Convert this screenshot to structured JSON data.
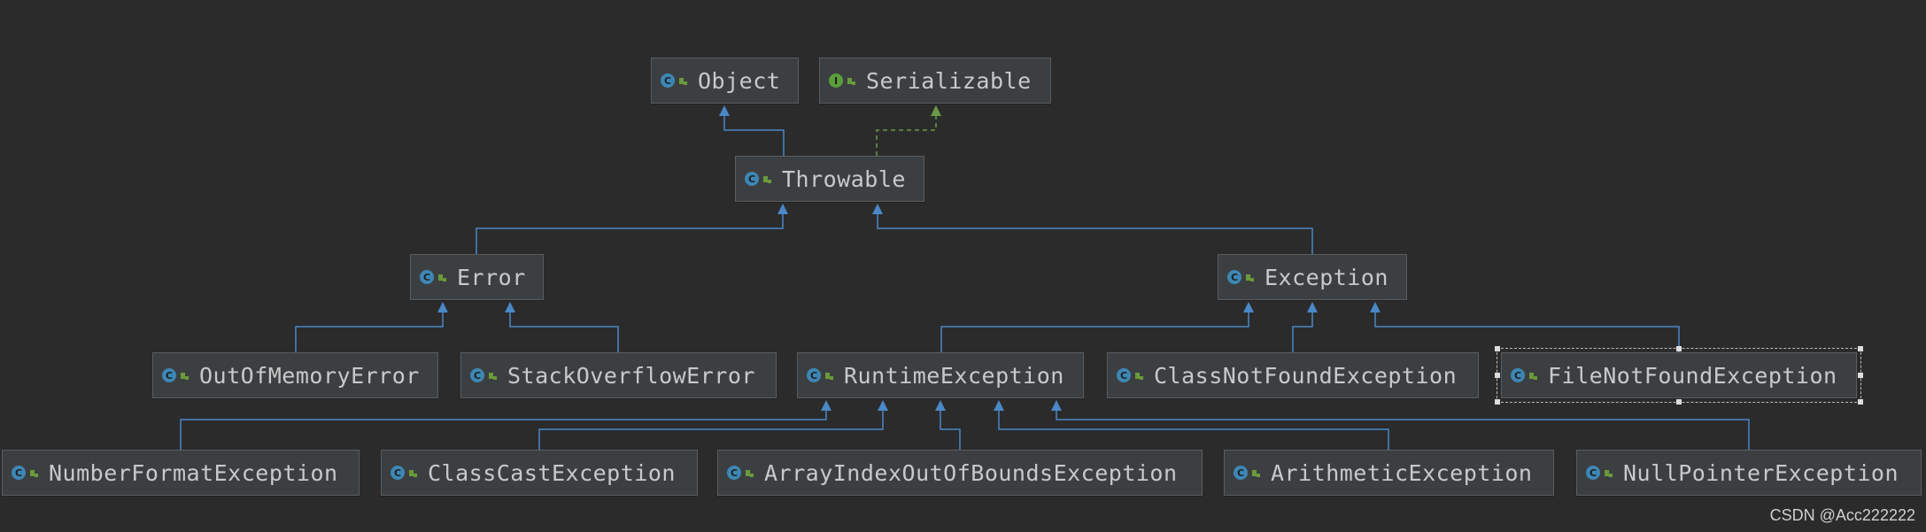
{
  "diagram": {
    "nodes": [
      {
        "id": "object",
        "label": "Object",
        "kind": "class",
        "icon": "class-icon"
      },
      {
        "id": "serializable",
        "label": "Serializable",
        "kind": "interface",
        "icon": "interface-icon"
      },
      {
        "id": "throwable",
        "label": "Throwable",
        "kind": "class",
        "icon": "class-icon"
      },
      {
        "id": "error",
        "label": "Error",
        "kind": "class",
        "icon": "class-icon"
      },
      {
        "id": "exception",
        "label": "Exception",
        "kind": "class",
        "icon": "class-icon"
      },
      {
        "id": "out_of_memory_error",
        "label": "OutOfMemoryError",
        "kind": "class",
        "icon": "class-icon"
      },
      {
        "id": "stack_overflow_error",
        "label": "StackOverflowError",
        "kind": "class",
        "icon": "class-icon"
      },
      {
        "id": "runtime_exception",
        "label": "RuntimeException",
        "kind": "class",
        "icon": "class-icon"
      },
      {
        "id": "class_not_found_exception",
        "label": "ClassNotFoundException",
        "kind": "class",
        "icon": "class-icon"
      },
      {
        "id": "file_not_found_exception",
        "label": "FileNotFoundException",
        "kind": "class",
        "icon": "class-icon",
        "selected": true
      },
      {
        "id": "number_format_exception",
        "label": "NumberFormatException",
        "kind": "class",
        "icon": "class-icon"
      },
      {
        "id": "class_cast_exception",
        "label": "ClassCastException",
        "kind": "class",
        "icon": "class-icon"
      },
      {
        "id": "array_index_out_of_bounds_exception",
        "label": "ArrayIndexOutOfBoundsException",
        "kind": "class",
        "icon": "class-icon"
      },
      {
        "id": "arithmetic_exception",
        "label": "ArithmeticException",
        "kind": "class",
        "icon": "class-icon"
      },
      {
        "id": "null_pointer_exception",
        "label": "NullPointerException",
        "kind": "class",
        "icon": "class-icon"
      }
    ],
    "edges": [
      {
        "from": "throwable",
        "to": "object",
        "type": "extends"
      },
      {
        "from": "throwable",
        "to": "serializable",
        "type": "implements"
      },
      {
        "from": "error",
        "to": "throwable",
        "type": "extends"
      },
      {
        "from": "exception",
        "to": "throwable",
        "type": "extends"
      },
      {
        "from": "out_of_memory_error",
        "to": "error",
        "type": "extends"
      },
      {
        "from": "stack_overflow_error",
        "to": "error",
        "type": "extends"
      },
      {
        "from": "runtime_exception",
        "to": "exception",
        "type": "extends"
      },
      {
        "from": "class_not_found_exception",
        "to": "exception",
        "type": "extends"
      },
      {
        "from": "file_not_found_exception",
        "to": "exception",
        "type": "extends"
      },
      {
        "from": "number_format_exception",
        "to": "runtime_exception",
        "type": "extends"
      },
      {
        "from": "class_cast_exception",
        "to": "runtime_exception",
        "type": "extends"
      },
      {
        "from": "array_index_out_of_bounds_exception",
        "to": "runtime_exception",
        "type": "extends"
      },
      {
        "from": "arithmetic_exception",
        "to": "runtime_exception",
        "type": "extends"
      },
      {
        "from": "null_pointer_exception",
        "to": "runtime_exception",
        "type": "extends"
      }
    ]
  },
  "colors": {
    "background": "#2b2b2b",
    "node_fill": "#3c3f41",
    "node_border": "#5a5d5f",
    "label": "#c9c9c9",
    "extends_edge": "#4a88c7",
    "implements_edge": "#6a9a4a",
    "class_icon": "#3d87b5",
    "interface_icon": "#5a9e3a",
    "public_marker": "#6a9a3a"
  },
  "watermark": "CSDN @Acc222222"
}
